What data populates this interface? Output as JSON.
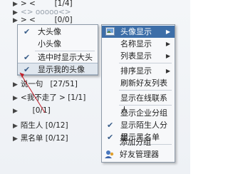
{
  "background_list": [
    {
      "text": "> <",
      "suffix": "[1/4]"
    },
    {
      "text": "<> ooooo<>",
      "suffix": ""
    },
    {
      "text": "> <",
      "suffix": "[0/0]"
    },
    {
      "text": "说一句",
      "suffix": "[27/51]"
    },
    {
      "text": "<我不走了 >",
      "suffix": "[1/1]"
    },
    {
      "text": "",
      "suffix": "[0/1]"
    },
    {
      "text": "陌生人",
      "suffix": "[0/12]"
    },
    {
      "text": "黑名单",
      "suffix": "[0/12]"
    }
  ],
  "left_menu": {
    "items": [
      {
        "label": "大头像",
        "checked": true
      },
      {
        "label": "小头像",
        "checked": false
      },
      {
        "label": "选中时显示大头像",
        "checked": true
      },
      {
        "label": "显示我的头像",
        "checked": true
      }
    ]
  },
  "right_menu": {
    "items": [
      {
        "label": "头像显示",
        "icon": "avatar-display-icon",
        "submenu": true,
        "checked": false
      },
      {
        "label": "名称显示",
        "submenu": true,
        "checked": false
      },
      {
        "label": "列表显示",
        "submenu": true,
        "checked": false
      },
      {
        "label": "排序显示",
        "submenu": true,
        "checked": false
      },
      {
        "label": "刷新好友列表",
        "submenu": false,
        "checked": false
      },
      {
        "label": "显示在线联系人",
        "submenu": false,
        "checked": false
      },
      {
        "label": "显示企业分组",
        "submenu": false,
        "checked": false
      },
      {
        "label": "显示陌生人分组",
        "submenu": false,
        "checked": true
      },
      {
        "label": "显示黑名单",
        "submenu": false,
        "checked": true
      },
      {
        "label": "添加分组",
        "submenu": false,
        "checked": false
      },
      {
        "label": "好友管理器",
        "icon": "friend-manager-icon",
        "submenu": false,
        "checked": false
      }
    ]
  },
  "colors": {
    "highlight": "#3d6ea8",
    "menu_bg": "#f7f8fa",
    "menu_border": "#8e9aa8",
    "pointer": "#c0202a"
  }
}
